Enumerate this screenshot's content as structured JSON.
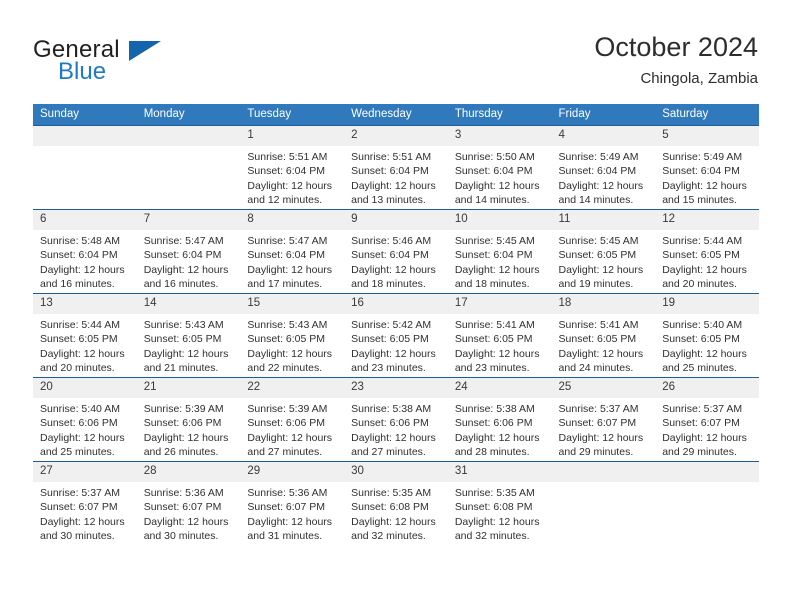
{
  "brand": {
    "name_top": "General",
    "name_bottom": "Blue",
    "logo_icon": "triangle-logo-icon"
  },
  "header": {
    "title": "October 2024",
    "subtitle": "Chingola, Zambia"
  },
  "calendar": {
    "weekday_headers": [
      "Sunday",
      "Monday",
      "Tuesday",
      "Wednesday",
      "Thursday",
      "Friday",
      "Saturday"
    ],
    "accent_color": "#3079bd",
    "header_border_color": "#1f5d96",
    "daynum_bg": "#f0f0f0",
    "weeks": [
      [
        {
          "day": "",
          "empty": true,
          "lines": []
        },
        {
          "day": "",
          "empty": true,
          "lines": []
        },
        {
          "day": "1",
          "lines": [
            "Sunrise: 5:51 AM",
            "Sunset: 6:04 PM",
            "Daylight: 12 hours",
            "and 12 minutes."
          ]
        },
        {
          "day": "2",
          "lines": [
            "Sunrise: 5:51 AM",
            "Sunset: 6:04 PM",
            "Daylight: 12 hours",
            "and 13 minutes."
          ]
        },
        {
          "day": "3",
          "lines": [
            "Sunrise: 5:50 AM",
            "Sunset: 6:04 PM",
            "Daylight: 12 hours",
            "and 14 minutes."
          ]
        },
        {
          "day": "4",
          "lines": [
            "Sunrise: 5:49 AM",
            "Sunset: 6:04 PM",
            "Daylight: 12 hours",
            "and 14 minutes."
          ]
        },
        {
          "day": "5",
          "lines": [
            "Sunrise: 5:49 AM",
            "Sunset: 6:04 PM",
            "Daylight: 12 hours",
            "and 15 minutes."
          ]
        }
      ],
      [
        {
          "day": "6",
          "lines": [
            "Sunrise: 5:48 AM",
            "Sunset: 6:04 PM",
            "Daylight: 12 hours",
            "and 16 minutes."
          ]
        },
        {
          "day": "7",
          "lines": [
            "Sunrise: 5:47 AM",
            "Sunset: 6:04 PM",
            "Daylight: 12 hours",
            "and 16 minutes."
          ]
        },
        {
          "day": "8",
          "lines": [
            "Sunrise: 5:47 AM",
            "Sunset: 6:04 PM",
            "Daylight: 12 hours",
            "and 17 minutes."
          ]
        },
        {
          "day": "9",
          "lines": [
            "Sunrise: 5:46 AM",
            "Sunset: 6:04 PM",
            "Daylight: 12 hours",
            "and 18 minutes."
          ]
        },
        {
          "day": "10",
          "lines": [
            "Sunrise: 5:45 AM",
            "Sunset: 6:04 PM",
            "Daylight: 12 hours",
            "and 18 minutes."
          ]
        },
        {
          "day": "11",
          "lines": [
            "Sunrise: 5:45 AM",
            "Sunset: 6:05 PM",
            "Daylight: 12 hours",
            "and 19 minutes."
          ]
        },
        {
          "day": "12",
          "lines": [
            "Sunrise: 5:44 AM",
            "Sunset: 6:05 PM",
            "Daylight: 12 hours",
            "and 20 minutes."
          ]
        }
      ],
      [
        {
          "day": "13",
          "lines": [
            "Sunrise: 5:44 AM",
            "Sunset: 6:05 PM",
            "Daylight: 12 hours",
            "and 20 minutes."
          ]
        },
        {
          "day": "14",
          "lines": [
            "Sunrise: 5:43 AM",
            "Sunset: 6:05 PM",
            "Daylight: 12 hours",
            "and 21 minutes."
          ]
        },
        {
          "day": "15",
          "lines": [
            "Sunrise: 5:43 AM",
            "Sunset: 6:05 PM",
            "Daylight: 12 hours",
            "and 22 minutes."
          ]
        },
        {
          "day": "16",
          "lines": [
            "Sunrise: 5:42 AM",
            "Sunset: 6:05 PM",
            "Daylight: 12 hours",
            "and 23 minutes."
          ]
        },
        {
          "day": "17",
          "lines": [
            "Sunrise: 5:41 AM",
            "Sunset: 6:05 PM",
            "Daylight: 12 hours",
            "and 23 minutes."
          ]
        },
        {
          "day": "18",
          "lines": [
            "Sunrise: 5:41 AM",
            "Sunset: 6:05 PM",
            "Daylight: 12 hours",
            "and 24 minutes."
          ]
        },
        {
          "day": "19",
          "lines": [
            "Sunrise: 5:40 AM",
            "Sunset: 6:05 PM",
            "Daylight: 12 hours",
            "and 25 minutes."
          ]
        }
      ],
      [
        {
          "day": "20",
          "lines": [
            "Sunrise: 5:40 AM",
            "Sunset: 6:06 PM",
            "Daylight: 12 hours",
            "and 25 minutes."
          ]
        },
        {
          "day": "21",
          "lines": [
            "Sunrise: 5:39 AM",
            "Sunset: 6:06 PM",
            "Daylight: 12 hours",
            "and 26 minutes."
          ]
        },
        {
          "day": "22",
          "lines": [
            "Sunrise: 5:39 AM",
            "Sunset: 6:06 PM",
            "Daylight: 12 hours",
            "and 27 minutes."
          ]
        },
        {
          "day": "23",
          "lines": [
            "Sunrise: 5:38 AM",
            "Sunset: 6:06 PM",
            "Daylight: 12 hours",
            "and 27 minutes."
          ]
        },
        {
          "day": "24",
          "lines": [
            "Sunrise: 5:38 AM",
            "Sunset: 6:06 PM",
            "Daylight: 12 hours",
            "and 28 minutes."
          ]
        },
        {
          "day": "25",
          "lines": [
            "Sunrise: 5:37 AM",
            "Sunset: 6:07 PM",
            "Daylight: 12 hours",
            "and 29 minutes."
          ]
        },
        {
          "day": "26",
          "lines": [
            "Sunrise: 5:37 AM",
            "Sunset: 6:07 PM",
            "Daylight: 12 hours",
            "and 29 minutes."
          ]
        }
      ],
      [
        {
          "day": "27",
          "lines": [
            "Sunrise: 5:37 AM",
            "Sunset: 6:07 PM",
            "Daylight: 12 hours",
            "and 30 minutes."
          ]
        },
        {
          "day": "28",
          "lines": [
            "Sunrise: 5:36 AM",
            "Sunset: 6:07 PM",
            "Daylight: 12 hours",
            "and 30 minutes."
          ]
        },
        {
          "day": "29",
          "lines": [
            "Sunrise: 5:36 AM",
            "Sunset: 6:07 PM",
            "Daylight: 12 hours",
            "and 31 minutes."
          ]
        },
        {
          "day": "30",
          "lines": [
            "Sunrise: 5:35 AM",
            "Sunset: 6:08 PM",
            "Daylight: 12 hours",
            "and 32 minutes."
          ]
        },
        {
          "day": "31",
          "lines": [
            "Sunrise: 5:35 AM",
            "Sunset: 6:08 PM",
            "Daylight: 12 hours",
            "and 32 minutes."
          ]
        },
        {
          "day": "",
          "empty": true,
          "lines": []
        },
        {
          "day": "",
          "empty": true,
          "lines": []
        }
      ]
    ]
  }
}
